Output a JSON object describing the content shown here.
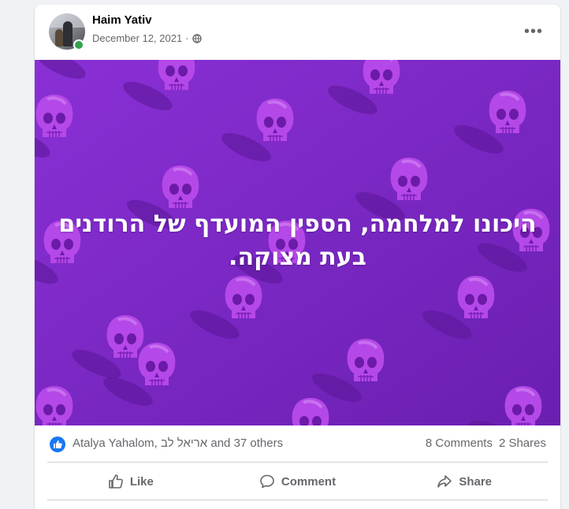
{
  "post": {
    "author": "Haim Yativ",
    "date": "December 12, 2021",
    "date_separator": "·",
    "privacy_icon": "globe-icon",
    "more_icon": "more-horizontal-icon",
    "more_label": "•••",
    "image_text": "היכונו למלחמה, הספין המועדף של הרודנים בעת מצוקה.",
    "image_background": "#7a26c4",
    "reactions": {
      "reactors_text": "Atalya Yahalom, אריאל לב and 37 others",
      "comments": "8 Comments",
      "shares": "2 Shares"
    },
    "actions": [
      {
        "label": "Like",
        "icon": "thumbs-up-icon"
      },
      {
        "label": "Comment",
        "icon": "comment-icon"
      },
      {
        "label": "Share",
        "icon": "share-icon"
      }
    ]
  },
  "colors": {
    "accent": "#1877f2",
    "online": "#31a24c",
    "secondary_text": "#65676b",
    "primary_text": "#050505"
  }
}
